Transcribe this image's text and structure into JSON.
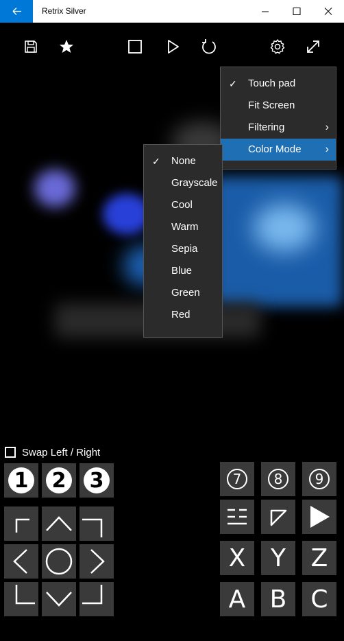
{
  "window": {
    "title": "Retrix Silver"
  },
  "toolbar": {
    "icons": [
      "save-icon",
      "favorite-star-icon",
      "stop-icon",
      "play-icon",
      "reset-icon",
      "settings-icon",
      "fullscreen-icon"
    ]
  },
  "settings_menu": {
    "items": [
      {
        "label": "Touch pad",
        "checked": true,
        "submenu": false
      },
      {
        "label": "Fit Screen",
        "checked": false,
        "submenu": false
      },
      {
        "label": "Filtering",
        "checked": false,
        "submenu": true
      },
      {
        "label": "Color Mode",
        "checked": false,
        "submenu": true,
        "highlighted": true
      }
    ]
  },
  "color_menu": {
    "items": [
      {
        "label": "None",
        "checked": true
      },
      {
        "label": "Grayscale"
      },
      {
        "label": "Cool"
      },
      {
        "label": "Warm"
      },
      {
        "label": "Sepia"
      },
      {
        "label": "Blue"
      },
      {
        "label": "Green"
      },
      {
        "label": "Red"
      }
    ]
  },
  "controls": {
    "swap_label": "Swap Left / Right",
    "swap_checked": false,
    "left_numbers": [
      "1",
      "2",
      "3"
    ],
    "right_numbers": [
      "7",
      "8",
      "9"
    ],
    "letters_top": [
      "X",
      "Y",
      "Z"
    ],
    "letters_bottom": [
      "A",
      "B",
      "C"
    ]
  },
  "colors": {
    "accent": "#0078d7",
    "menu_bg": "#2b2b2b",
    "menu_highlight": "#1f6fb5",
    "pad_bg": "#3a3a3a"
  }
}
